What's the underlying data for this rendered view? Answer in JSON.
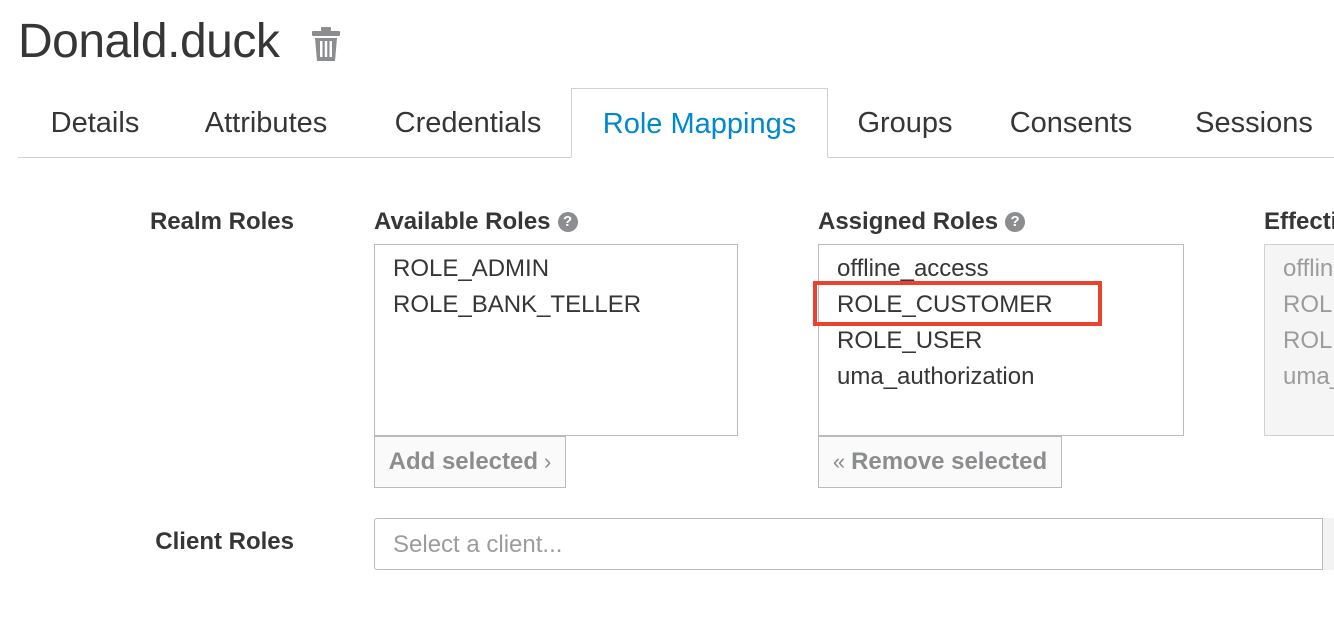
{
  "header": {
    "title": "Donald.duck",
    "delete_icon": "trash-icon"
  },
  "tabs": [
    {
      "label": "Details",
      "active": false
    },
    {
      "label": "Attributes",
      "active": false
    },
    {
      "label": "Credentials",
      "active": false
    },
    {
      "label": "Role Mappings",
      "active": true
    },
    {
      "label": "Groups",
      "active": false
    },
    {
      "label": "Consents",
      "active": false
    },
    {
      "label": "Sessions",
      "active": false
    }
  ],
  "realm_roles": {
    "label": "Realm Roles",
    "available": {
      "label": "Available Roles",
      "help_icon": "?",
      "items": [
        "ROLE_ADMIN",
        "ROLE_BANK_TELLER"
      ],
      "button_label": "Add selected",
      "button_chevron": "›"
    },
    "assigned": {
      "label": "Assigned Roles",
      "help_icon": "?",
      "items": [
        "offline_access",
        "ROLE_CUSTOMER",
        "ROLE_USER",
        "uma_authorization"
      ],
      "highlighted_item": "ROLE_CUSTOMER",
      "button_label": "Remove selected",
      "button_chevron": "«"
    },
    "effective": {
      "label": "Effecti",
      "items": [
        "offlin",
        "ROLE",
        "ROLE",
        "uma_"
      ]
    }
  },
  "client_roles": {
    "label": "Client Roles",
    "placeholder": "Select a client..."
  },
  "colors": {
    "accent": "#0088ce",
    "highlight": "#e8432e",
    "text": "#363636",
    "muted": "#8b8d8f"
  }
}
